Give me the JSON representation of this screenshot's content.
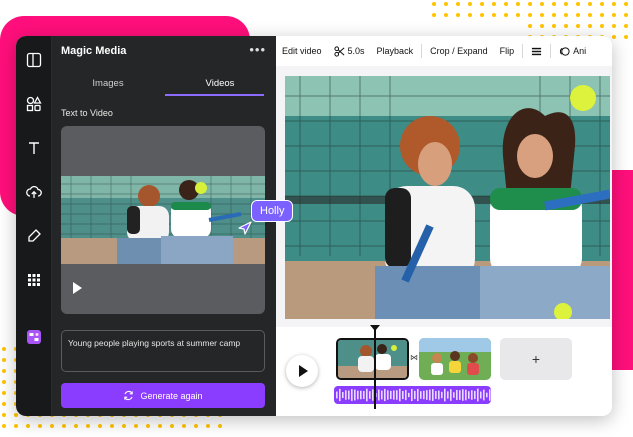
{
  "panel": {
    "title": "Magic Media",
    "menu_label": "•••",
    "tabs": [
      {
        "label": "Images"
      },
      {
        "label": "Videos"
      }
    ],
    "section_label": "Text to Video",
    "prompt_text": "Young people playing sports at summer camp",
    "generate_label": "Generate again"
  },
  "collaborator": {
    "name": "Holly"
  },
  "toolbar": {
    "edit_video": "Edit video",
    "duration": "5.0s",
    "playback": "Playback",
    "crop_expand": "Crop / Expand",
    "flip": "Flip",
    "animate": "Ani"
  },
  "timeline": {
    "add_label": "+"
  },
  "colors": {
    "accent": "#8b3dff",
    "brand_pink": "#ff0f7b",
    "dots": "#ffc400",
    "panel_bg": "#252627",
    "collaborator": "#7b61ff"
  },
  "icons": {
    "rail": [
      "layout-icon",
      "elements-icon",
      "text-icon",
      "upload-icon",
      "draw-icon",
      "apps-icon",
      "magic-media-icon"
    ]
  }
}
